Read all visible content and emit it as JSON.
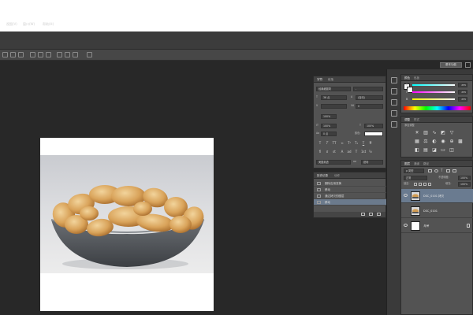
{
  "app": {
    "title": "Photoshop"
  },
  "menu": [
    {
      "label": "视图(V)"
    },
    {
      "label": "窗口(W)"
    },
    {
      "label": "帮助(H)"
    }
  ],
  "workspace": {
    "label": "基本功能"
  },
  "document": {
    "image_description": "Bowl of almonds (nuts) in a grey dish"
  },
  "character_panel": {
    "tabs": [
      "字符",
      "段落"
    ],
    "font_family": "经典细圆简",
    "font_style": "-",
    "font_size": "36 点",
    "leading": "(自动)",
    "kerning": "",
    "tracking": "0",
    "vertical_scale": "100%",
    "horizontal_scale": "100%",
    "baseline_shift": "0 点",
    "color_label": "颜色:",
    "language": "美国英语",
    "antialias": "锐利",
    "antialias_short": "aa"
  },
  "history_panel": {
    "tabs": [
      "历史记录",
      "动作"
    ],
    "items": [
      {
        "label": "删除应用变换",
        "selected": false
      },
      {
        "label": "移动",
        "selected": false
      },
      {
        "label": "通过拷贝的图层",
        "selected": false
      },
      {
        "label": "移动",
        "selected": true
      }
    ]
  },
  "color_panel": {
    "tabs": [
      "颜色",
      "色板"
    ],
    "channels": [
      {
        "label": "R",
        "value": "255",
        "color": "#e05050"
      },
      {
        "label": "G",
        "value": "255",
        "color": "#50c050"
      },
      {
        "label": "B",
        "value": "255",
        "color": "#5050e0"
      }
    ]
  },
  "adjustments_panel": {
    "tabs": [
      "调整",
      "样式"
    ],
    "title": "添加调整",
    "icons": [
      "brightness-icon",
      "levels-icon",
      "curves-icon",
      "exposure-icon",
      "vibrance-icon",
      "hsl-icon",
      "color-balance-icon",
      "bw-icon",
      "photo-filter-icon",
      "channel-mixer-icon",
      "color-lookup-icon",
      "invert-icon",
      "posterize-icon",
      "threshold-icon",
      "gradient-map-icon",
      "selective-color-icon"
    ]
  },
  "layers_panel": {
    "tabs": [
      "图层",
      "通道",
      "路径"
    ],
    "filter_label": "ρ 类型",
    "blend_mode": "正常",
    "opacity_label": "不透明度:",
    "opacity_value": "100%",
    "lock_label": "锁定:",
    "fill_label": "填充:",
    "fill_value": "100%",
    "layers": [
      {
        "name": "DSC_0101 拷贝",
        "selected": true,
        "thumb": "photo",
        "locked": false
      },
      {
        "name": "DSC_0101",
        "selected": false,
        "thumb": "photo",
        "locked": false
      },
      {
        "name": "背景",
        "selected": false,
        "thumb": "white",
        "locked": true
      }
    ]
  }
}
